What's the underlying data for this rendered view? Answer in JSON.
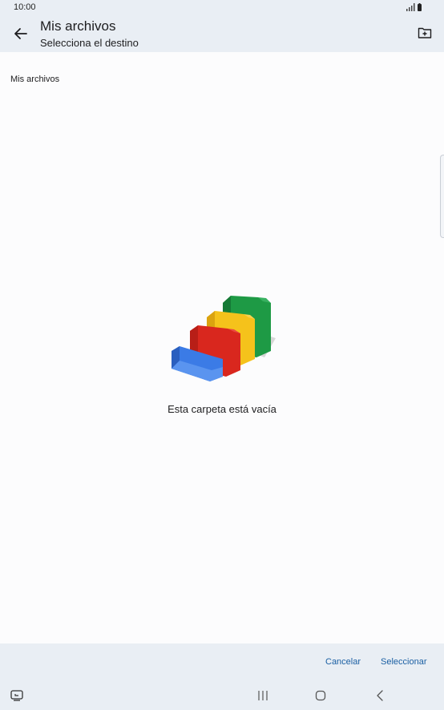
{
  "status_bar": {
    "time": "10:00",
    "icons": [
      "signal-icon",
      "battery-icon"
    ]
  },
  "app_bar": {
    "title": "Mis archivos",
    "subtitle": "Selecciona el destino",
    "icons": [
      "back-arrow-icon",
      "new-folder-icon"
    ]
  },
  "breadcrumb": "Mis archivos",
  "empty_state": {
    "message": "Esta carpeta está vacía",
    "colors": [
      "#3b7be6",
      "#d9271e",
      "#f5c21b",
      "#1e9a45"
    ]
  },
  "actions": {
    "cancel": "Cancelar",
    "select": "Seleccionar"
  },
  "nav_bar": {
    "icons": [
      "screenshot-icon",
      "recent-apps-icon",
      "home-icon",
      "back-icon"
    ]
  }
}
